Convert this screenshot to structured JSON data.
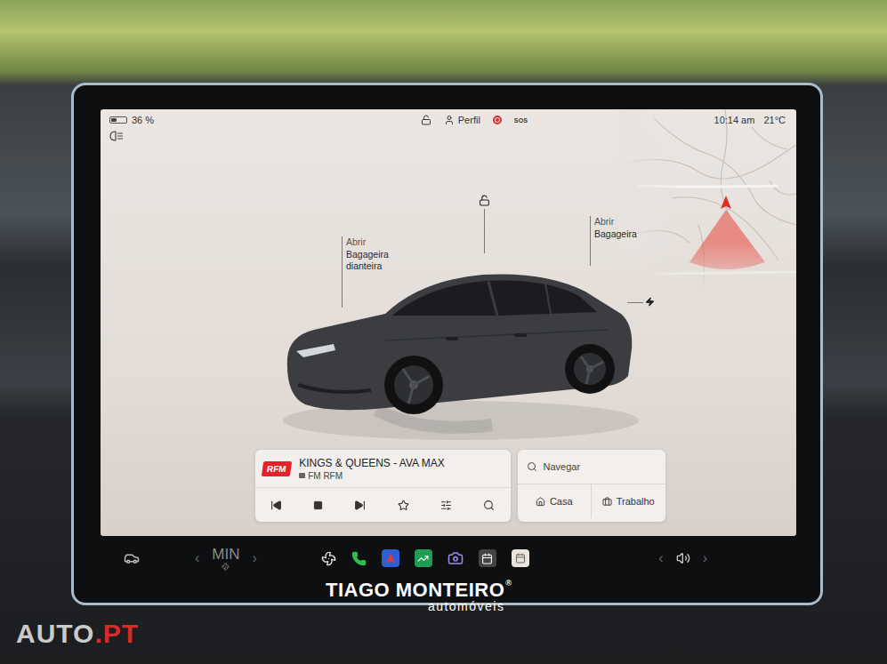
{
  "status_bar": {
    "battery": {
      "reading": "36 %",
      "level": 0.36
    },
    "locked": false,
    "profile": "Perfil",
    "dashcam_recording": true,
    "sos": "SOS",
    "time": "10:14 am",
    "temperature": "21°C"
  },
  "car": {
    "locked": false,
    "labels": [
      {
        "action": "Abrir",
        "target": "Bagageira dianteira"
      },
      {
        "action": "Abrir",
        "target": "Bagageira"
      }
    ]
  },
  "media": {
    "logo": "RFM",
    "title": "KINGS & QUEENS - AVA MAX",
    "source": "FM RFM",
    "playing": true
  },
  "navigation": {
    "placeholder": "Navegar",
    "shortcuts": [
      "Casa",
      "Trabalho"
    ]
  },
  "dock": {
    "climate": {
      "prev": "‹",
      "label": "MIN",
      "next": "›"
    },
    "volume": {
      "prev": "‹",
      "next": "›"
    }
  },
  "watermarks": {
    "dealer": "TIAGO MONTEIRO",
    "registered": "®",
    "dealer_sub": "automóveis",
    "site": "AUTO",
    "site_tld": ".PT"
  }
}
